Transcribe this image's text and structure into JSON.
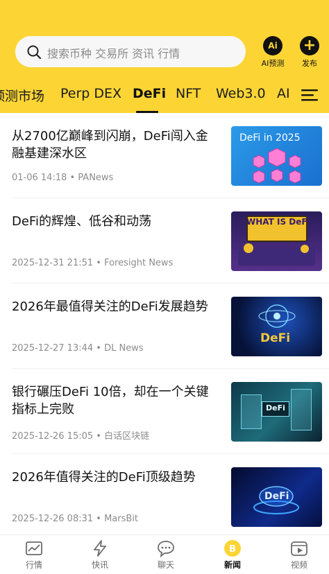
{
  "search": {
    "placeholder": "搜索币种 交易所 资讯 行情"
  },
  "header_actions": [
    {
      "label": "AI预测",
      "icon": "ai-predict-icon",
      "glyph": "Ai"
    },
    {
      "label": "发布",
      "icon": "plus-icon",
      "glyph": "+"
    }
  ],
  "tabs": [
    "预测市场",
    "Perp DEX",
    "DeFi",
    "NFT",
    "Web3.0",
    "AI"
  ],
  "active_tab": "DeFi",
  "articles": [
    {
      "title": "从2700亿巅峰到闪崩，DeFi闯入金融基建深水区",
      "meta": "01-06 14:18 • PANews",
      "thumb_text": "DeFi in 2025"
    },
    {
      "title": "DeFi的辉煌、低谷和动荡",
      "meta": "2025-12-31 21:51 • Foresight News",
      "thumb_text": "WHAT IS DeFi"
    },
    {
      "title": "2026年最值得关注的DeFi发展趋势",
      "meta": "2025-12-27 13:44 • DL News",
      "thumb_text": "DeFi"
    },
    {
      "title": "银行碾压DeFi 10倍，却在一个关键指标上完败",
      "meta": "2025-12-26 15:05 • 白话区块链",
      "thumb_text": "DeFi"
    },
    {
      "title": "2026年值得关注的DeFi顶级趋势",
      "meta": "2025-12-26 08:31 • MarsBit",
      "thumb_text": "DeFi"
    }
  ],
  "bottom_nav": [
    {
      "label": "行情",
      "icon": "chart-icon"
    },
    {
      "label": "快讯",
      "icon": "lightning-icon"
    },
    {
      "label": "聊天",
      "icon": "chat-icon"
    },
    {
      "label": "新闻",
      "icon": "news-coin-icon",
      "active": true
    },
    {
      "label": "视频",
      "icon": "video-icon"
    }
  ],
  "colors": {
    "brand_yellow": "#fcd535",
    "text_primary": "#111111",
    "text_secondary": "#8c8c8c"
  }
}
